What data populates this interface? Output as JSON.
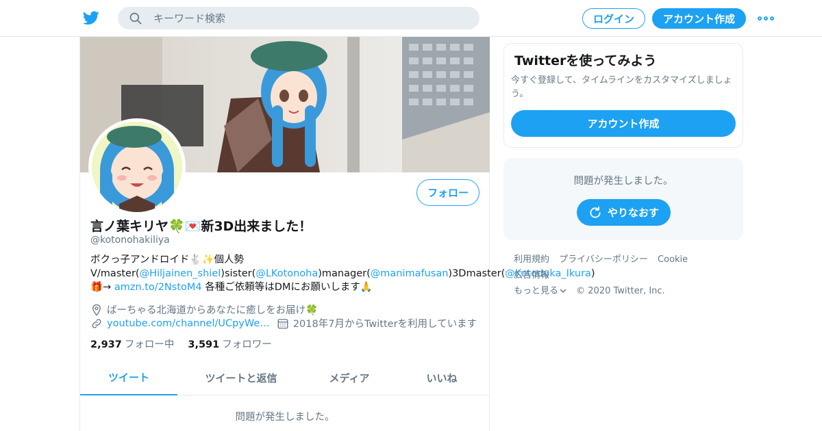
{
  "header": {
    "search_placeholder": "キーワード検索",
    "login_label": "ログイン",
    "signup_label": "アカウント作成"
  },
  "profile": {
    "follow_label": "フォロー",
    "display_name": "言ノ葉キリヤ🍀💌新3D出来ました！",
    "handle": "@kotonohakiliya",
    "bio": {
      "line1": "ボクっ子アンドロイド🐇✨個人勢",
      "p1": "V/master(",
      "link1": "@Hiljainen_shiel",
      "p2": ")sister(",
      "link2": "@LKotonoha",
      "p3": ")manager(",
      "link3": "@manimafusan",
      "p4": ")3Dmaster(",
      "link4": "@Kotoduka_Ikura",
      "p5": ")🎁→ ",
      "link5": "amzn.to/2NstoM4",
      "p6": " 各種ご依頼等はDMにお願いします🙏"
    },
    "location": "ばーちゃる北海道からあなたに癒しをお届け🍀",
    "url": "youtube.com/channel/UCpyWe…",
    "joined": "2018年7月からTwitterを利用しています",
    "following_count": "2,937",
    "following_label": "フォロー中",
    "followers_count": "3,591",
    "followers_label": "フォロワー"
  },
  "tabs": [
    {
      "label": "ツイート"
    },
    {
      "label": "ツイートと返信"
    },
    {
      "label": "メディア"
    },
    {
      "label": "いいね"
    }
  ],
  "main_error": "問題が発生しました。",
  "sidebar": {
    "card_title": "Twitterを使ってみよう",
    "card_text": "今すぐ登録して、タイムラインをカスタマイズしましょう。",
    "card_button": "アカウント作成",
    "error_text": "問題が発生しました。",
    "retry_label": "やりなおす"
  },
  "footer": {
    "links": [
      "利用規約",
      "プライバシーポリシー",
      "Cookie",
      "広告情報",
      "もっと見る"
    ],
    "copyright": "© 2020 Twitter, Inc."
  },
  "colors": {
    "accent": "#1da1f2",
    "text": "#14171a",
    "muted": "#657786"
  }
}
